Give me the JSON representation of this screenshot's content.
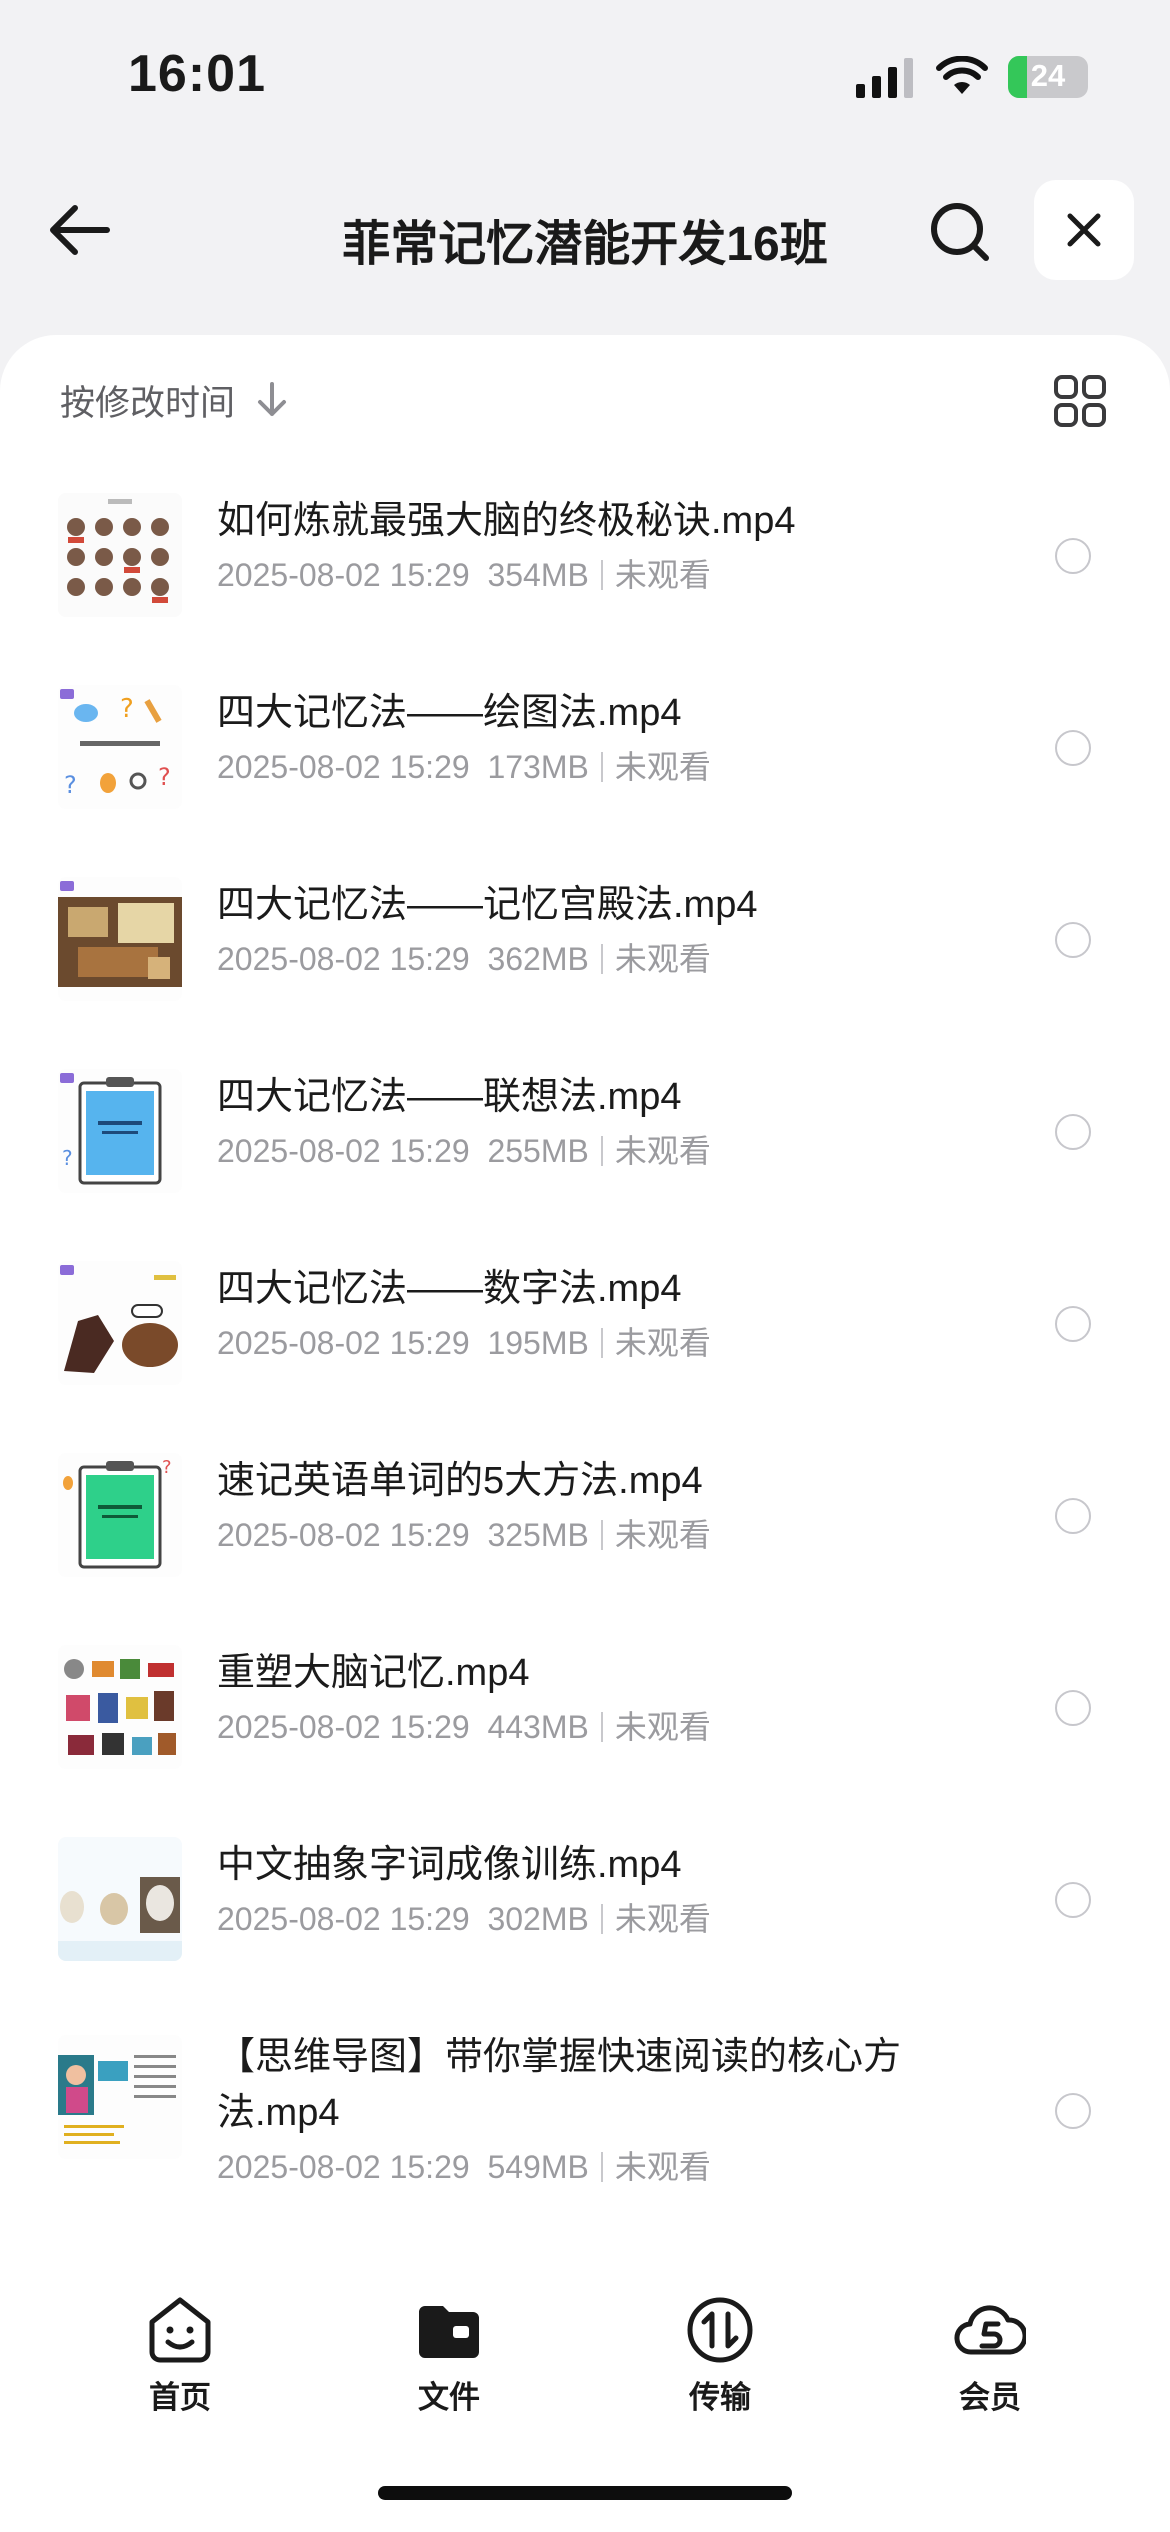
{
  "status_bar": {
    "time": "16:01",
    "battery_level": "24",
    "icons": [
      "cellular-signal-icon",
      "wifi-icon",
      "battery-charging-icon"
    ]
  },
  "header": {
    "title": "菲常记忆潜能开发16班",
    "icons": [
      "back-arrow-icon",
      "search-icon",
      "close-icon"
    ]
  },
  "sort": {
    "label": "按修改时间",
    "icon": "sort-down-arrow-icon"
  },
  "view_toggle_icon": "grid-view-icon",
  "files": [
    {
      "name": "如何炼就最强大脑的终极秘诀.mp4",
      "date": "2025-08-02 15:29",
      "size": "354MB",
      "status": "未观看"
    },
    {
      "name": " 四大记忆法——绘图法.mp4",
      "date": "2025-08-02 15:29",
      "size": "173MB",
      "status": "未观看"
    },
    {
      "name": "  四大记忆法——记忆宫殿法.mp4",
      "date": "2025-08-02 15:29",
      "size": "362MB",
      "status": "未观看"
    },
    {
      "name": " 四大记忆法——联想法.mp4",
      "date": "2025-08-02 15:29",
      "size": "255MB",
      "status": "未观看"
    },
    {
      "name": " 四大记忆法——数字法.mp4",
      "date": "2025-08-02 15:29",
      "size": "195MB",
      "status": "未观看"
    },
    {
      "name": "速记英语单词的5大方法.mp4",
      "date": "2025-08-02 15:29",
      "size": "325MB",
      "status": "未观看"
    },
    {
      "name": "重塑大脑记忆.mp4",
      "date": "2025-08-02 15:29",
      "size": "443MB",
      "status": "未观看"
    },
    {
      "name": "中文抽象字词成像训练.mp4",
      "date": "2025-08-02 15:29",
      "size": "302MB",
      "status": "未观看"
    },
    {
      "name": "【思维导图】带你掌握快速阅读的核心方法.mp4",
      "date": "2025-08-02 15:29",
      "size": "549MB",
      "status": "未观看"
    }
  ],
  "tabs": [
    {
      "label": "首页",
      "icon": "home-smiley-icon"
    },
    {
      "label": "文件",
      "icon": "folder-icon",
      "active": true
    },
    {
      "label": "传输",
      "icon": "transfer-icon"
    },
    {
      "label": "会员",
      "icon": "member-cloud-icon"
    }
  ],
  "colors": {
    "background": "#f2f2f4",
    "sheet": "#ffffff",
    "meta_text": "#9b9b9f",
    "battery_green": "#34c759"
  }
}
